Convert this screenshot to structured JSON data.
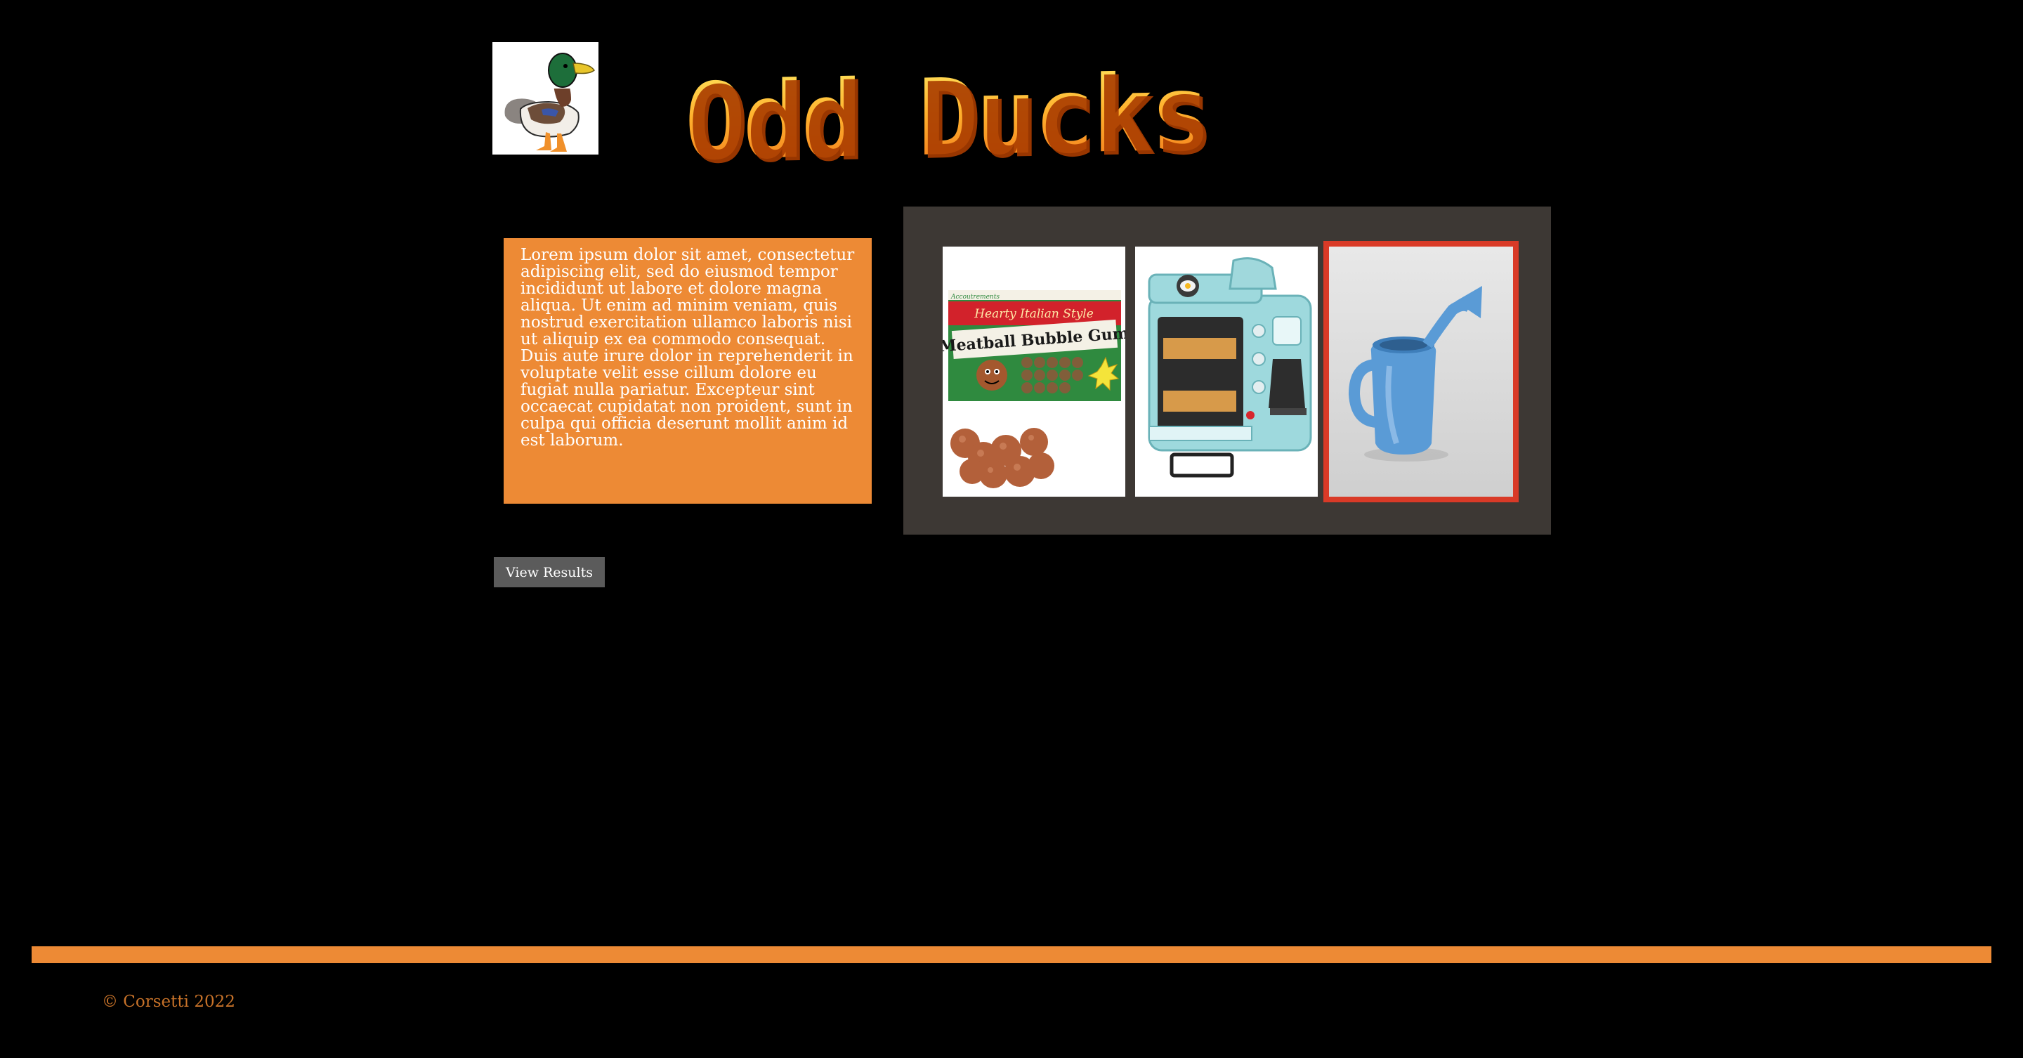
{
  "header": {
    "title": "Odd Ducks",
    "logo_icon": "duck-icon"
  },
  "description": {
    "text": "Lorem ipsum dolor sit amet, consectetur adipiscing elit, sed do eiusmod tempor incididunt ut labore et dolore magna aliqua. Ut enim ad minim veniam, quis nostrud exercitation ullamco laboris nisi ut aliquip ex ea commodo consequat. Duis aute irure dolor in reprehenderit in voluptate velit esse cillum dolore eu fugiat nulla pariatur. Excepteur sint occaecat cupidatat non proident, sunt in culpa qui officia deserunt mollit anim id est laborum."
  },
  "products": [
    {
      "name": "meatball-bubble-gum",
      "package_label_top": "Hearty Italian Style",
      "package_label_main": "Meatball Bubble Gum",
      "brand": "Accoutrements"
    },
    {
      "name": "breakfast-station"
    },
    {
      "name": "watering-can",
      "selected": true
    }
  ],
  "actions": {
    "view_results_label": "View Results"
  },
  "footer": {
    "copyright": "© Corsetti 2022"
  },
  "colors": {
    "background": "#000000",
    "accent_orange": "#ed8a35",
    "gallery_bg": "#3d3834",
    "selected_border": "#d93a27",
    "button_bg": "#5b5b5b"
  }
}
